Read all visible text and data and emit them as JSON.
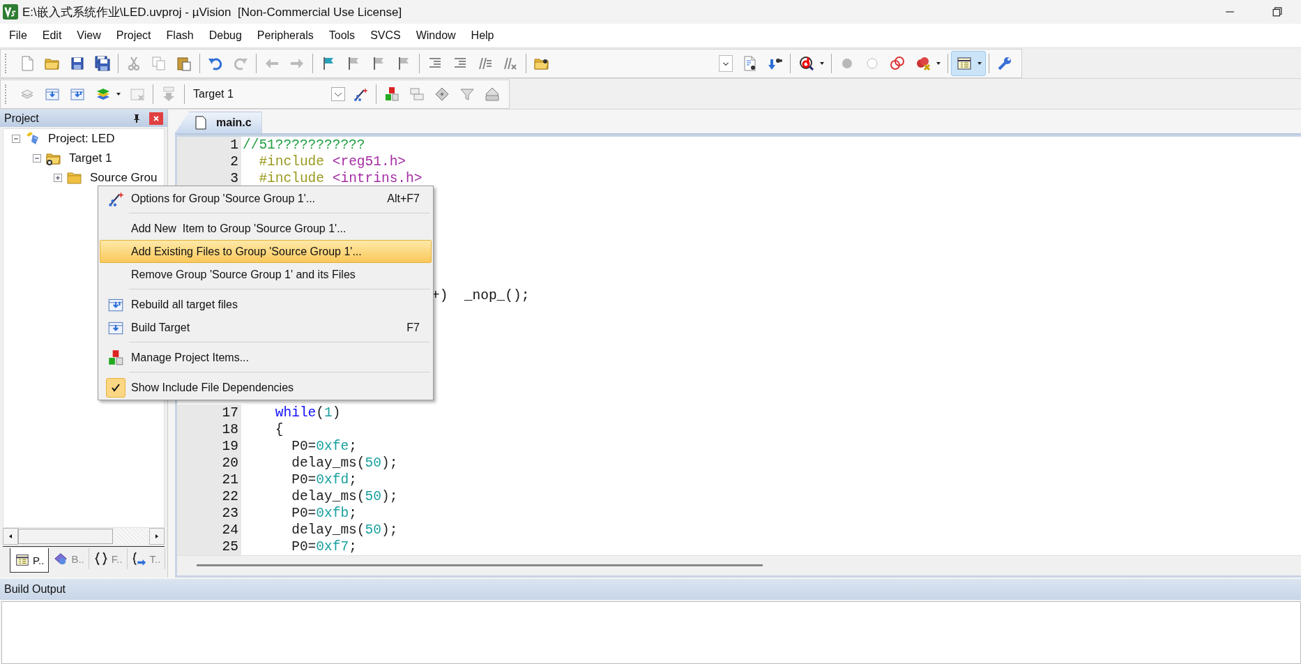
{
  "window": {
    "title": "E:\\嵌入式系统作业\\LED.uvproj - µVision  [Non-Commercial Use License]"
  },
  "menu_bar": [
    "File",
    "Edit",
    "View",
    "Project",
    "Flash",
    "Debug",
    "Peripherals",
    "Tools",
    "SVCS",
    "Window",
    "Help"
  ],
  "build_toolbar": {
    "target": "Target 1"
  },
  "project_panel": {
    "title": "Project",
    "tree": [
      {
        "label": "Project: LED",
        "expanded": true,
        "children": [
          {
            "label": "Target 1",
            "expanded": true,
            "children": [
              {
                "label": "Source Grou",
                "expanded": false
              }
            ]
          }
        ]
      }
    ],
    "tabs": [
      {
        "label": "P..",
        "selected": true
      },
      {
        "label": "B..",
        "selected": false
      },
      {
        "label": "F..",
        "selected": false
      },
      {
        "label": "T..",
        "selected": false
      }
    ]
  },
  "editor": {
    "tabs": [
      {
        "label": "main.c",
        "selected": true
      }
    ],
    "lines": [
      {
        "number": "1",
        "tokens": [
          {
            "kind": "comment",
            "text": "//51???????????"
          }
        ]
      },
      {
        "number": "2",
        "tokens": [
          {
            "kind": "preproc",
            "text": "  #include"
          },
          {
            "kind": "header",
            "text": " <reg51.h>"
          }
        ]
      },
      {
        "number": "3",
        "tokens": [
          {
            "kind": "preproc",
            "text": "  #include"
          },
          {
            "kind": "header",
            "text": " <intrins.h>"
          }
        ]
      },
      {
        "tail": "+)  _nop_();"
      },
      {
        "number": "17",
        "tokens": [
          {
            "kind": "keyword",
            "text": "    while"
          },
          {
            "kind": "plain",
            "text": "("
          },
          {
            "kind": "number",
            "text": "1"
          },
          {
            "kind": "plain",
            "text": ")"
          }
        ]
      },
      {
        "number": "18",
        "tokens": [
          {
            "kind": "plain",
            "text": "    {"
          }
        ]
      },
      {
        "number": "19",
        "tokens": [
          {
            "kind": "plain",
            "text": "      P0="
          },
          {
            "kind": "number",
            "text": "0xfe"
          },
          {
            "kind": "plain",
            "text": ";"
          }
        ]
      },
      {
        "number": "20",
        "tokens": [
          {
            "kind": "plain",
            "text": "      delay_ms("
          },
          {
            "kind": "number",
            "text": "50"
          },
          {
            "kind": "plain",
            "text": ");"
          }
        ]
      },
      {
        "number": "21",
        "tokens": [
          {
            "kind": "plain",
            "text": "      P0="
          },
          {
            "kind": "number",
            "text": "0xfd"
          },
          {
            "kind": "plain",
            "text": ";"
          }
        ]
      },
      {
        "number": "22",
        "tokens": [
          {
            "kind": "plain",
            "text": "      delay_ms("
          },
          {
            "kind": "number",
            "text": "50"
          },
          {
            "kind": "plain",
            "text": ");"
          }
        ]
      },
      {
        "number": "23",
        "tokens": [
          {
            "kind": "plain",
            "text": "      P0="
          },
          {
            "kind": "number",
            "text": "0xfb"
          },
          {
            "kind": "plain",
            "text": ";"
          }
        ]
      },
      {
        "number": "24",
        "tokens": [
          {
            "kind": "plain",
            "text": "      delay_ms("
          },
          {
            "kind": "number",
            "text": "50"
          },
          {
            "kind": "plain",
            "text": ");"
          }
        ]
      },
      {
        "number": "25",
        "tokens": [
          {
            "kind": "plain",
            "text": "      P0="
          },
          {
            "kind": "number",
            "text": "0xf7"
          },
          {
            "kind": "plain",
            "text": ";"
          }
        ]
      }
    ]
  },
  "context_menu": {
    "groups": [
      [
        {
          "label": "Options for Group 'Source Group 1'...",
          "shortcut": "Alt+F7",
          "selected": false,
          "checked": false
        }
      ],
      [
        {
          "label": "Add New  Item to Group 'Source Group 1'...",
          "selected": false,
          "checked": false
        },
        {
          "label": "Add Existing Files to Group 'Source Group 1'...",
          "selected": true,
          "checked": false
        },
        {
          "label": "Remove Group 'Source Group 1' and its Files",
          "selected": false,
          "checked": false
        }
      ],
      [
        {
          "label": "Rebuild all target files",
          "selected": false,
          "checked": false
        },
        {
          "label": "Build Target",
          "shortcut": "F7",
          "selected": false,
          "checked": false
        }
      ],
      [
        {
          "label": "Manage Project Items...",
          "selected": false,
          "checked": false
        }
      ],
      [
        {
          "label": "Show Include File Dependencies",
          "selected": false,
          "checked": true
        }
      ]
    ]
  },
  "build_output": {
    "title": "Build Output"
  }
}
